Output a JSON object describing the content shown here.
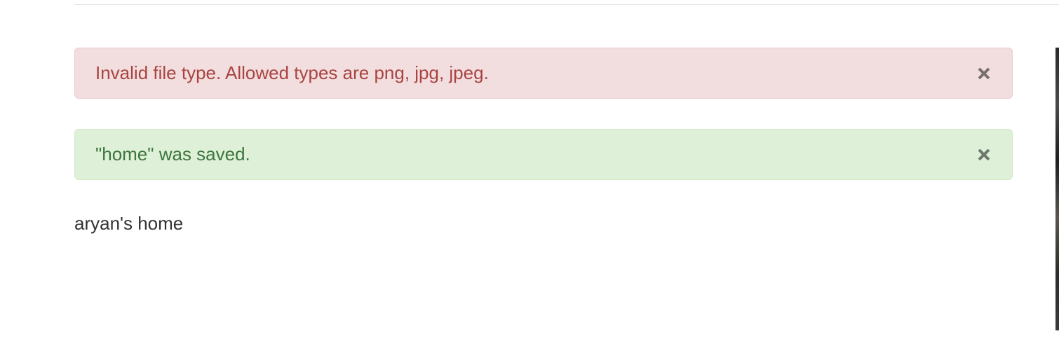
{
  "alerts": {
    "error": {
      "message": "Invalid file type. Allowed types are png, jpg, jpeg.",
      "close_icon": "close-icon",
      "color": "#a94442"
    },
    "success": {
      "message": "\"home\" was saved.",
      "close_icon": "close-icon",
      "color": "#3c763d"
    }
  },
  "main": {
    "home_title": "aryan's home"
  }
}
